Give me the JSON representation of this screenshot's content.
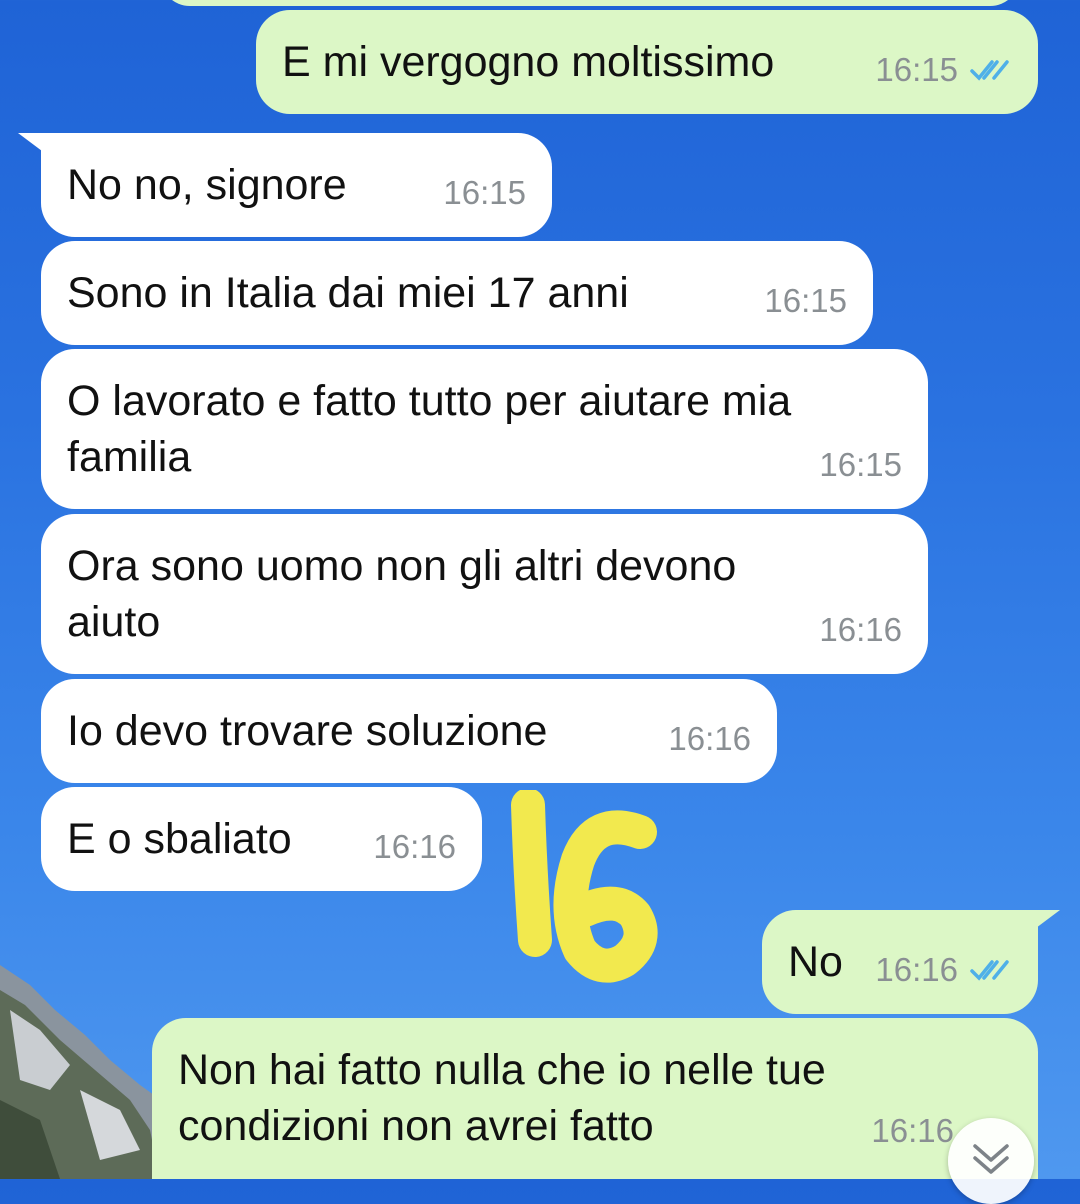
{
  "colors": {
    "incoming_bubble": "#ffffff",
    "outgoing_bubble": "#dcf7c6",
    "read_ticks": "#4fb0e8",
    "sticker": "#f2e94e"
  },
  "messages": [
    {
      "direction": "out",
      "text": "E mi vergogno moltissimo",
      "time": "16:15",
      "status": "read"
    },
    {
      "direction": "in",
      "text": "No no, signore",
      "time": "16:15"
    },
    {
      "direction": "in",
      "text": "Sono in Italia dai miei 17 anni",
      "time": "16:15"
    },
    {
      "direction": "in",
      "text": "O lavorato e fatto tutto per aiutare mia\nfamilia",
      "time": "16:15"
    },
    {
      "direction": "in",
      "text": "Ora sono uomo non gli altri devono\naiuto",
      "time": "16:16"
    },
    {
      "direction": "in",
      "text": "Io devo trovare soluzione",
      "time": "16:16"
    },
    {
      "direction": "in",
      "text": "E o sbaliato",
      "time": "16:16"
    },
    {
      "direction": "out",
      "text": "No",
      "time": "16:16",
      "status": "read"
    },
    {
      "direction": "out",
      "text": "Non hai fatto nulla che io nelle tue\ncondizioni non avrei fatto",
      "time": "16:16",
      "status": "read"
    }
  ],
  "sticker": {
    "text": "16"
  },
  "scroll_button": {
    "icon": "double-chevron-down-icon"
  }
}
